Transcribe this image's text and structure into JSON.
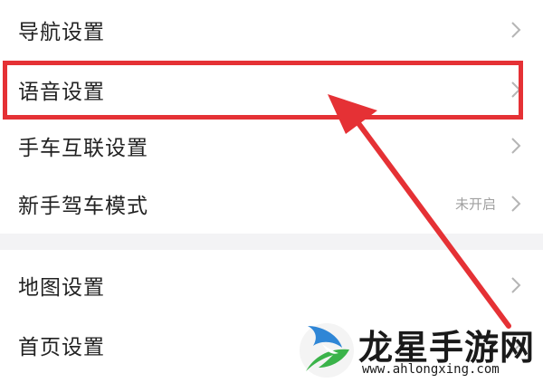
{
  "settings": {
    "group1": [
      {
        "label": "导航设置",
        "status": ""
      },
      {
        "label": "语音设置",
        "status": ""
      },
      {
        "label": "手车互联设置",
        "status": ""
      },
      {
        "label": "新手驾车模式",
        "status": "未开启"
      }
    ],
    "group2": [
      {
        "label": "地图设置",
        "status": ""
      },
      {
        "label": "首页设置",
        "status": ""
      }
    ]
  },
  "annotation": {
    "color": "#e53135"
  },
  "watermark": {
    "title": "龙星手游网",
    "url": "www.ahlongxing.com"
  }
}
